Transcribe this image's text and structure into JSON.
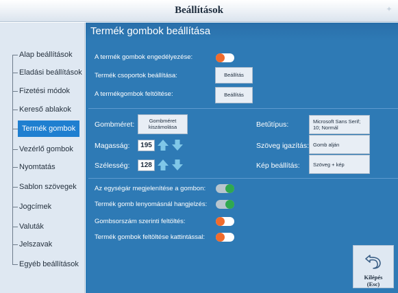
{
  "window": {
    "title": "Beállítások"
  },
  "sidebar": {
    "items": [
      {
        "label": "Alap beállítások"
      },
      {
        "label": "Eladási beállítások"
      },
      {
        "label": "Fizetési módok"
      },
      {
        "label": "Kereső ablakok"
      },
      {
        "label": "Termék gombok",
        "active": true
      },
      {
        "label": "Vezérlő gombok"
      },
      {
        "label": "Nyomtatás"
      },
      {
        "label": "Sablon szövegek"
      },
      {
        "label": "Jogcímek"
      },
      {
        "label": "Valuták"
      },
      {
        "label": "Jelszavak"
      },
      {
        "label": "Egyéb beállítások"
      }
    ]
  },
  "main": {
    "title": "Termék gombok beállítása",
    "enable": {
      "label": "A termék gombok engedélyezése:",
      "state": "off"
    },
    "groups": {
      "label": "Termék csoportok beállítása:",
      "button": "Beállítás"
    },
    "load": {
      "label": "A termékgombok feltöltése:",
      "button": "Beállítás"
    },
    "size": {
      "label": "Gombméret:",
      "calc_button": "Gombméret kiszámolása",
      "height_label": "Magasság:",
      "height_value": "195",
      "width_label": "Szélesség:",
      "width_value": "128"
    },
    "font": {
      "label": "Betűtípus:",
      "value": "Microsoft Sans Serif; 10; Normál"
    },
    "text_align": {
      "label": "Szöveg igazítás:",
      "value": "Gomb alján"
    },
    "image": {
      "label": "Kép beállítás:",
      "value": "Szöveg + kép"
    },
    "toggles": [
      {
        "label": "Az egységár megjelenítése a gombon:",
        "state": "on"
      },
      {
        "label": "Termék gomb lenyomásnál hangjelzés:",
        "state": "on"
      },
      {
        "label": "Gombsorszám szerinti feltöltés:",
        "state": "off"
      },
      {
        "label": "Termék gombok feltöltése kattintással:",
        "state": "off"
      }
    ],
    "exit": {
      "line1": "Kilépés",
      "line2": "(Esc)"
    }
  },
  "colors": {
    "accent_blue": "#2e7ab5",
    "active_item": "#1f7fd0",
    "toggle_on": "#2fa84f",
    "toggle_off": "#f06b2c",
    "arrow": "#7fc7e8"
  },
  "icons": {
    "up": "arrow-up-icon",
    "down": "arrow-down-icon",
    "exit": "undo-arrow-icon"
  }
}
